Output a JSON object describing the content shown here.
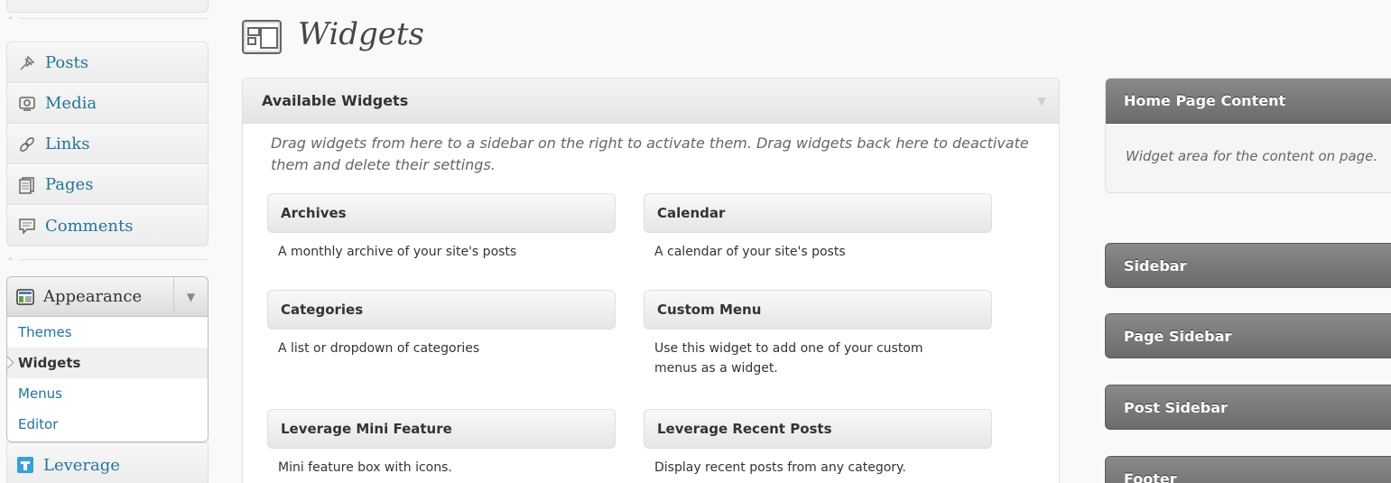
{
  "menu": {
    "items": [
      {
        "label": "Posts",
        "icon": "pushpin-icon"
      },
      {
        "label": "Media",
        "icon": "media-icon"
      },
      {
        "label": "Links",
        "icon": "links-icon"
      },
      {
        "label": "Pages",
        "icon": "pages-icon"
      },
      {
        "label": "Comments",
        "icon": "comments-icon"
      }
    ],
    "appearance": {
      "label": "Appearance",
      "submenu": [
        "Themes",
        "Widgets",
        "Menus",
        "Editor"
      ],
      "current": "Widgets"
    },
    "leverage": {
      "label": "Leverage"
    },
    "collapse_glyph": "«"
  },
  "page": {
    "title": "Widgets"
  },
  "available": {
    "title": "Available Widgets",
    "description": "Drag widgets from here to a sidebar on the right to activate them. Drag widgets back here to deactivate them and delete their settings.",
    "widgets": [
      {
        "title": "Archives",
        "desc": "A monthly archive of your site's posts"
      },
      {
        "title": "Calendar",
        "desc": "A calendar of your site's posts"
      },
      {
        "title": "Categories",
        "desc": "A list or dropdown of categories"
      },
      {
        "title": "Custom Menu",
        "desc": "Use this widget to add one of your custom menus as a widget."
      },
      {
        "title": "Leverage Mini Feature",
        "desc": "Mini feature box with icons."
      },
      {
        "title": "Leverage Recent Posts",
        "desc": "Display recent posts from any category."
      }
    ]
  },
  "sidebars": [
    {
      "title": "Home Page Content",
      "desc": "Widget area for the content on page."
    },
    {
      "title": "Sidebar"
    },
    {
      "title": "Page Sidebar"
    },
    {
      "title": "Post Sidebar"
    },
    {
      "title": "Footer"
    }
  ],
  "colors": {
    "link": "#21759b",
    "sidebar_header": "#6b6b6b"
  }
}
